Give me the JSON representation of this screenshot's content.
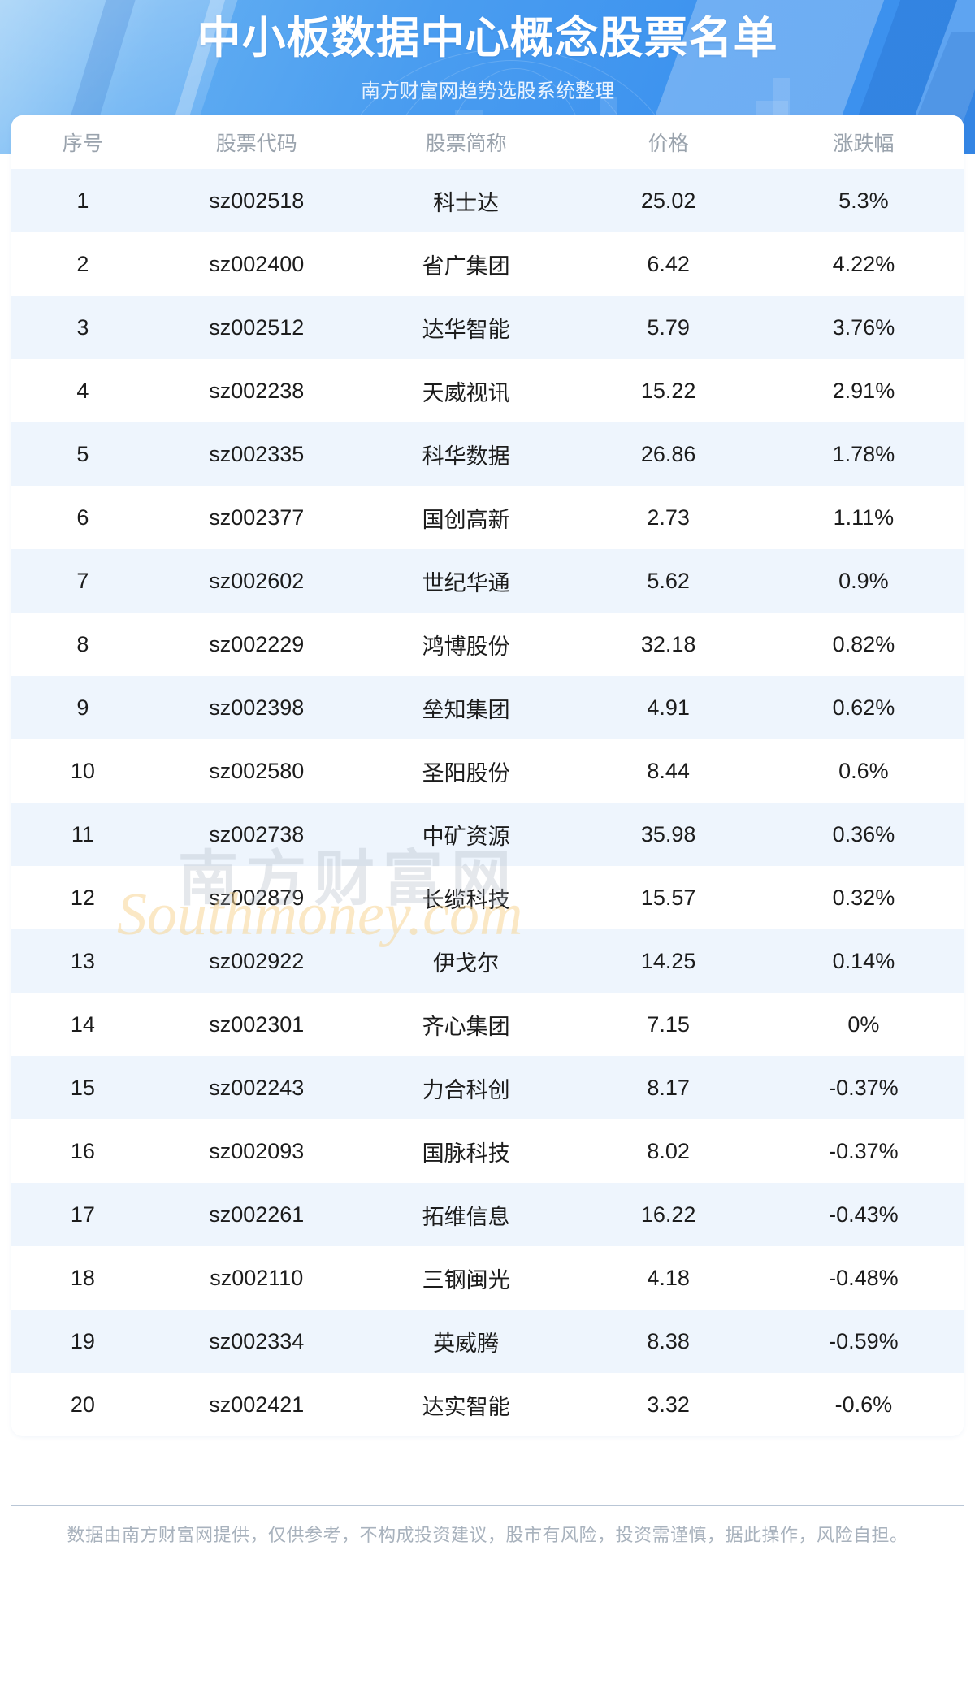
{
  "banner": {
    "title": "中小板数据中心概念股票名单",
    "subtitle": "南方财富网趋势选股系统整理",
    "colors": {
      "gradient_from": "#8ec7f5",
      "gradient_to": "#3b8fee",
      "title_color": "#ffffff",
      "subtitle_color": "#eaf4ff"
    }
  },
  "watermark": {
    "cn_text": "南方财富网",
    "en_text": "Southmoney.com",
    "cn_color": "#a8b2c0",
    "en_color": "#f8d696"
  },
  "table": {
    "columns": [
      {
        "key": "index",
        "label": "序号"
      },
      {
        "key": "code",
        "label": "股票代码"
      },
      {
        "key": "name",
        "label": "股票简称"
      },
      {
        "key": "price",
        "label": "价格"
      },
      {
        "key": "change",
        "label": "涨跌幅"
      }
    ],
    "header_color": "#9aa3ad",
    "row_odd_bg": "#eef5fd",
    "row_even_bg": "#ffffff",
    "rows": [
      {
        "index": "1",
        "code": "sz002518",
        "name": "科士达",
        "price": "25.02",
        "change": "5.3%"
      },
      {
        "index": "2",
        "code": "sz002400",
        "name": "省广集团",
        "price": "6.42",
        "change": "4.22%"
      },
      {
        "index": "3",
        "code": "sz002512",
        "name": "达华智能",
        "price": "5.79",
        "change": "3.76%"
      },
      {
        "index": "4",
        "code": "sz002238",
        "name": "天威视讯",
        "price": "15.22",
        "change": "2.91%"
      },
      {
        "index": "5",
        "code": "sz002335",
        "name": "科华数据",
        "price": "26.86",
        "change": "1.78%"
      },
      {
        "index": "6",
        "code": "sz002377",
        "name": "国创高新",
        "price": "2.73",
        "change": "1.11%"
      },
      {
        "index": "7",
        "code": "sz002602",
        "name": "世纪华通",
        "price": "5.62",
        "change": "0.9%"
      },
      {
        "index": "8",
        "code": "sz002229",
        "name": "鸿博股份",
        "price": "32.18",
        "change": "0.82%"
      },
      {
        "index": "9",
        "code": "sz002398",
        "name": "垒知集团",
        "price": "4.91",
        "change": "0.62%"
      },
      {
        "index": "10",
        "code": "sz002580",
        "name": "圣阳股份",
        "price": "8.44",
        "change": "0.6%"
      },
      {
        "index": "11",
        "code": "sz002738",
        "name": "中矿资源",
        "price": "35.98",
        "change": "0.36%"
      },
      {
        "index": "12",
        "code": "sz002879",
        "name": "长缆科技",
        "price": "15.57",
        "change": "0.32%"
      },
      {
        "index": "13",
        "code": "sz002922",
        "name": "伊戈尔",
        "price": "14.25",
        "change": "0.14%"
      },
      {
        "index": "14",
        "code": "sz002301",
        "name": "齐心集团",
        "price": "7.15",
        "change": "0%"
      },
      {
        "index": "15",
        "code": "sz002243",
        "name": "力合科创",
        "price": "8.17",
        "change": "-0.37%"
      },
      {
        "index": "16",
        "code": "sz002093",
        "name": "国脉科技",
        "price": "8.02",
        "change": "-0.37%"
      },
      {
        "index": "17",
        "code": "sz002261",
        "name": "拓维信息",
        "price": "16.22",
        "change": "-0.43%"
      },
      {
        "index": "18",
        "code": "sz002110",
        "name": "三钢闽光",
        "price": "4.18",
        "change": "-0.48%"
      },
      {
        "index": "19",
        "code": "sz002334",
        "name": "英威腾",
        "price": "8.38",
        "change": "-0.59%"
      },
      {
        "index": "20",
        "code": "sz002421",
        "name": "达实智能",
        "price": "3.32",
        "change": "-0.6%"
      }
    ]
  },
  "footer": {
    "disclaimer": "数据由南方财富网提供，仅供参考，不构成投资建议，股市有风险，投资需谨慎，据此操作，风险自担。",
    "color": "#a8b2bd"
  }
}
